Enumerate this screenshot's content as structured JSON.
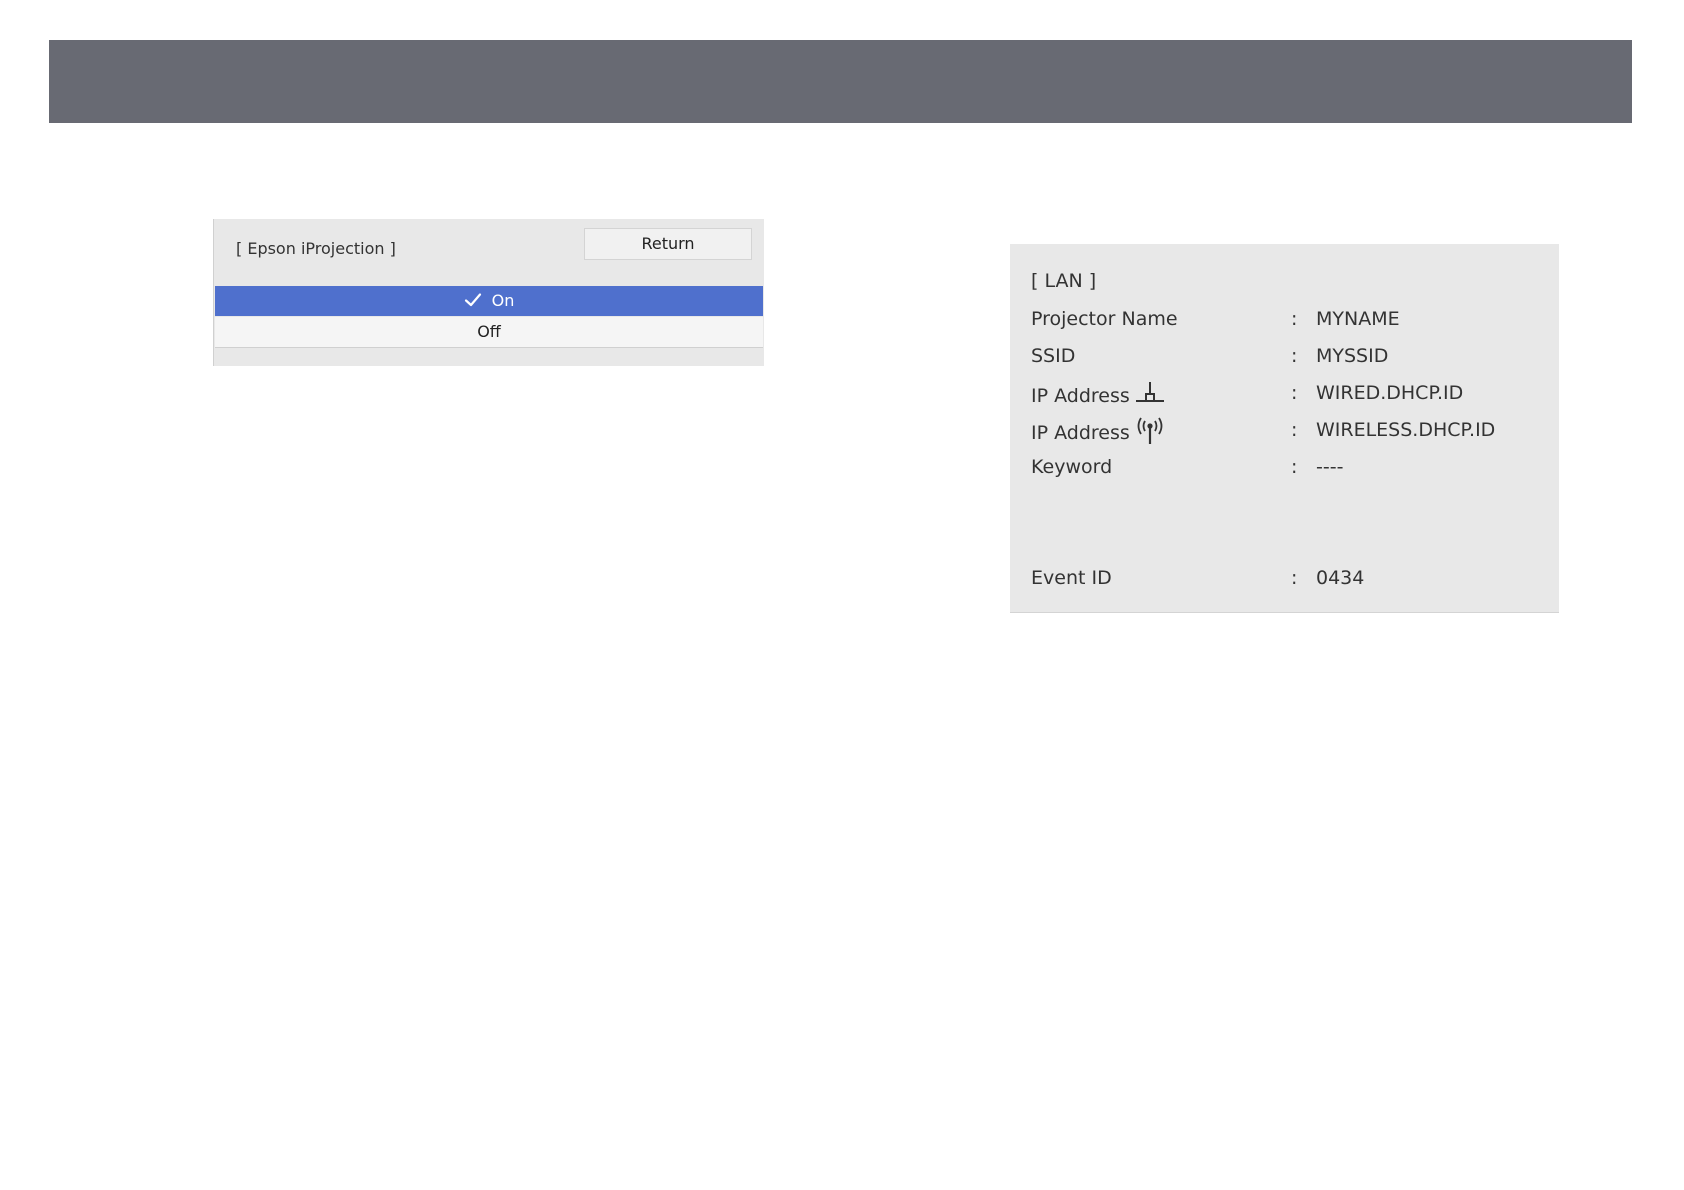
{
  "header": {
    "band_color": "#686a73"
  },
  "menu": {
    "title": "[ Epson iProjection ]",
    "return_label": "Return",
    "options": [
      {
        "label": "On",
        "selected": true
      },
      {
        "label": "Off",
        "selected": false
      }
    ],
    "selected_color": "#4f70cd"
  },
  "lan": {
    "heading": "[ LAN ]",
    "rows": [
      {
        "label": "Projector Name",
        "colon": ":",
        "value": "MYNAME"
      },
      {
        "label": "SSID",
        "colon": ":",
        "value": "MYSSID"
      },
      {
        "label": "IP Address",
        "icon": "wired-lan-icon",
        "colon": ":",
        "value": "WIRED.DHCP.ID"
      },
      {
        "label": "IP Address",
        "icon": "wireless-antenna-icon",
        "colon": ":",
        "value": "WIRELESS.DHCP.ID"
      },
      {
        "label": "Keyword",
        "colon": ":",
        "value": "----"
      },
      {
        "label": "Event ID",
        "colon": ":",
        "value": "0434"
      }
    ]
  }
}
